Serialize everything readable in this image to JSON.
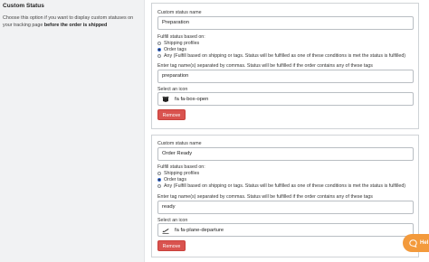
{
  "sidebar": {
    "title": "Custom Status",
    "description": "Choose this option if you want to display custom statuses on your tracking page",
    "description_bold": "before the order is shipped"
  },
  "cards": [
    {
      "name_label": "Custom status name",
      "name_value": "Preparation",
      "fulfill_label": "Fulfill status based on:",
      "options": [
        {
          "label": "Shipping profiles",
          "selected": false
        },
        {
          "label": "Order tags",
          "selected": true
        },
        {
          "label": "Any (Fulfill based on shipping or tags. Status will be fulfilled as one of these conditions is met the status is fulfilled)",
          "selected": false
        }
      ],
      "tags_label": "Enter tag name(s) separated by commas. Status will be fulfilled if the order contains any of these tags",
      "tags_value": "preparation",
      "icon_label": "Select an icon",
      "icon_value": "fa fa-box-open",
      "icon_name": "box-open-icon",
      "remove_label": "Remove"
    },
    {
      "name_label": "Custom status name",
      "name_value": "Order Ready",
      "fulfill_label": "Fulfill status based on:",
      "options": [
        {
          "label": "Shipping profiles",
          "selected": false
        },
        {
          "label": "Order tags",
          "selected": true
        },
        {
          "label": "Any (Fulfill based on shipping or tags. Status will be fulfilled as one of these conditions is met the status is fulfilled)",
          "selected": false
        }
      ],
      "tags_label": "Enter tag name(s) separated by commas. Status will be fulfilled if the order contains any of these tags",
      "tags_value": "ready",
      "icon_label": "Select an icon",
      "icon_value": "fa fa-plane-departure",
      "icon_name": "plane-departure-icon",
      "remove_label": "Remove"
    }
  ],
  "help": {
    "label": "Hel",
    "icon": "chat-icon",
    "color": "#f39a3c"
  },
  "colors": {
    "remove": "#d9534f",
    "radio_selected": "#2a2a2a",
    "sidebar_bg": "#f1f2f3"
  }
}
